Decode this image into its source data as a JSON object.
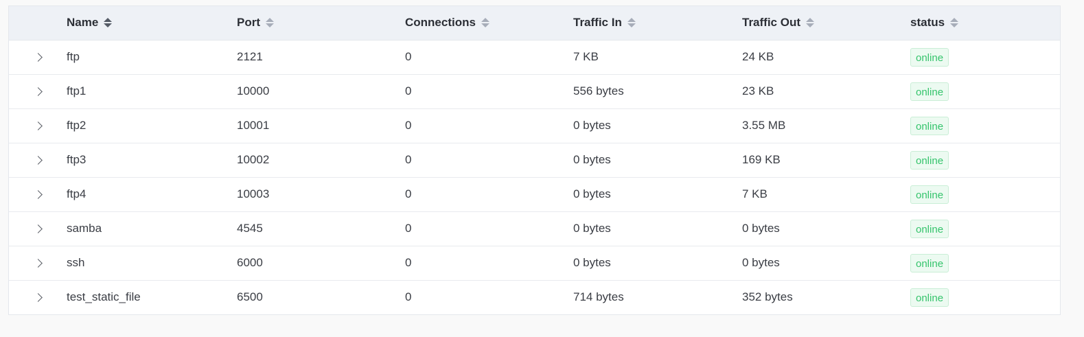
{
  "table": {
    "headers": {
      "name": "Name",
      "port": "Port",
      "connections": "Connections",
      "traffic_in": "Traffic In",
      "traffic_out": "Traffic Out",
      "status": "status"
    },
    "rows": [
      {
        "name": "ftp",
        "port": "2121",
        "connections": "0",
        "traffic_in": "7 KB",
        "traffic_out": "24 KB",
        "status": "online"
      },
      {
        "name": "ftp1",
        "port": "10000",
        "connections": "0",
        "traffic_in": "556 bytes",
        "traffic_out": "23 KB",
        "status": "online"
      },
      {
        "name": "ftp2",
        "port": "10001",
        "connections": "0",
        "traffic_in": "0 bytes",
        "traffic_out": "3.55 MB",
        "status": "online"
      },
      {
        "name": "ftp3",
        "port": "10002",
        "connections": "0",
        "traffic_in": "0 bytes",
        "traffic_out": "169 KB",
        "status": "online"
      },
      {
        "name": "ftp4",
        "port": "10003",
        "connections": "0",
        "traffic_in": "0 bytes",
        "traffic_out": "7 KB",
        "status": "online"
      },
      {
        "name": "samba",
        "port": "4545",
        "connections": "0",
        "traffic_in": "0 bytes",
        "traffic_out": "0 bytes",
        "status": "online"
      },
      {
        "name": "ssh",
        "port": "6000",
        "connections": "0",
        "traffic_in": "0 bytes",
        "traffic_out": "0 bytes",
        "status": "online"
      },
      {
        "name": "test_static_file",
        "port": "6500",
        "connections": "0",
        "traffic_in": "714 bytes",
        "traffic_out": "352 bytes",
        "status": "online"
      }
    ]
  },
  "colors": {
    "header_bg": "#eef1f6",
    "status_text": "#35c46c",
    "status_bg": "#ecfaf1",
    "status_border": "#c9eed6"
  },
  "icons": {
    "expand": "chevron-right-icon",
    "sort": "sort-caret-icon"
  }
}
